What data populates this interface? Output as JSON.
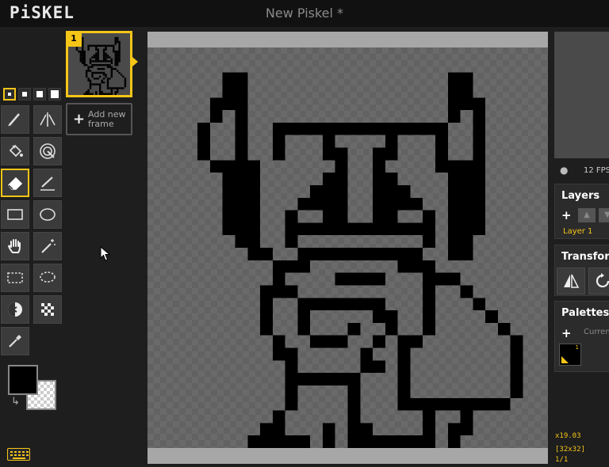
{
  "app": {
    "logo": "PiSKEL",
    "title": "New Piskel *"
  },
  "tools": {
    "pen_sizes": [
      1,
      2,
      3,
      4
    ],
    "selected_tool": "eraser-tool",
    "primary_color": "#000000",
    "secondary_color": "transparent"
  },
  "frames": {
    "items": [
      {
        "number": "1"
      }
    ],
    "add_frame_label": "Add new frame"
  },
  "preview": {
    "fps_label": "12 FPS"
  },
  "layers": {
    "title": "Layers",
    "items": [
      {
        "name": "Layer 1"
      }
    ]
  },
  "transform": {
    "title": "Transform"
  },
  "palettes": {
    "title": "Palettes",
    "current_label": "Current",
    "swatch_number": "1"
  },
  "status": {
    "zoom": "x19.03",
    "size": "[32x32]",
    "frame": "1/1"
  },
  "colors": {
    "accent": "#f5c518",
    "background": "#1e1e1e",
    "tool_bg": "#3b3b3b"
  },
  "sprite": {
    "grid_width": 32,
    "grid_height": 32,
    "rows": [
      "................................",
      "................................",
      "......##................##......",
      "......##................##......",
      ".....###................###.....",
      ".....#.#................#.#.....",
      "....#..#..##############..#.....",
      "....#..#..#...#....#...#..#.....",
      "....#..#..#...##..##...#..#.....",
      ".....####......#..#....####.....",
      "......###.....##..##....###.....",
      "......###....###..###...###.....",
      "......###...####..####..###.....",
      "......###..#..##..##..#.###.....",
      "......###..############.###.....",
      ".......##..#..........#.##......",
      "........##..##########..##......",
      "..........###.......###.........",
      "..........#....####...###.......",
      ".........###..........#..#......",
      ".........#..#######...#...#.....",
      ".........#..#.....##..#....#....",
      ".........#..#...#..#..#.....#...",
      "..........#..###..#.##.......#..",
      "..........##.....#..#........#..",
      "...........#.....##.#........#..",
      "...........######...#........#..",
      "...........#....#...#........#..",
      "...........#....#...#########...",
      "..........#.....#.....#..#......",
      ".........##...#.##....#.##......",
      "........#####.#.#######.#......."
    ]
  }
}
